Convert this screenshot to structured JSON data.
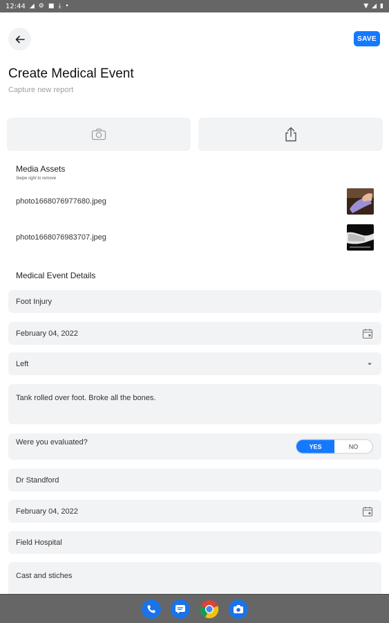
{
  "status_bar": {
    "time": "12:44"
  },
  "header": {
    "title": "Create Medical Event",
    "subtitle": "Capture new report",
    "save_label": "SAVE"
  },
  "media": {
    "section_title": "Media Assets",
    "hint": "Swipe right to remove",
    "assets": [
      {
        "filename": "photo1668076977680.jpeg"
      },
      {
        "filename": "photo1668076983707.jpeg"
      }
    ]
  },
  "details": {
    "section_title": "Medical Event Details",
    "injury": "Foot Injury",
    "date": "February 04, 2022",
    "side": "Left",
    "description": "Tank rolled over foot. Broke all the bones.",
    "evaluated_label": "Were you evaluated?",
    "toggle": {
      "yes": "YES",
      "no": "NO",
      "selected": "YES"
    },
    "doctor": "Dr Standford",
    "evaluation_date": "February 04, 2022",
    "facility": "Field Hospital",
    "treatment": "Cast and stiches"
  },
  "colors": {
    "accent": "#1479ff",
    "field_bg": "#f2f3f5",
    "system_bar": "#666666"
  }
}
